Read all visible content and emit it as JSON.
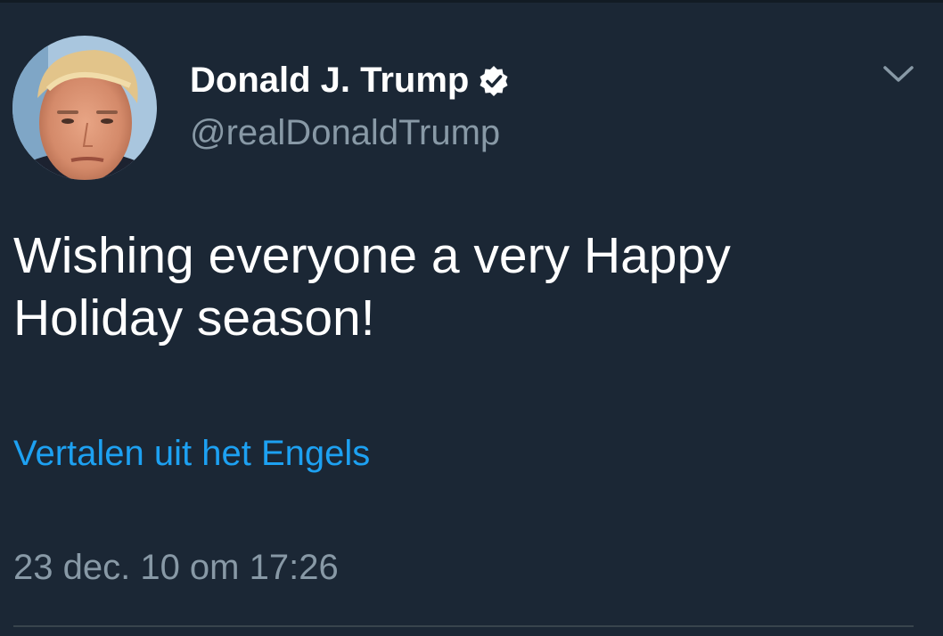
{
  "user": {
    "display_name": "Donald J. Trump",
    "handle": "@realDonaldTrump",
    "verified": true,
    "avatar_icon": "profile-photo"
  },
  "tweet": {
    "text_line1": "Wishing everyone a very Happy",
    "text_line2": "Holiday season!",
    "translate_label": "Vertalen uit het Engels",
    "timestamp": "23 dec. 10 om 17:26"
  },
  "icons": {
    "verified": "verified-badge-icon",
    "menu": "chevron-down-icon"
  },
  "colors": {
    "background": "#1b2735",
    "primary_text": "#ffffff",
    "secondary_text": "#8899a6",
    "link": "#1da1f2"
  }
}
